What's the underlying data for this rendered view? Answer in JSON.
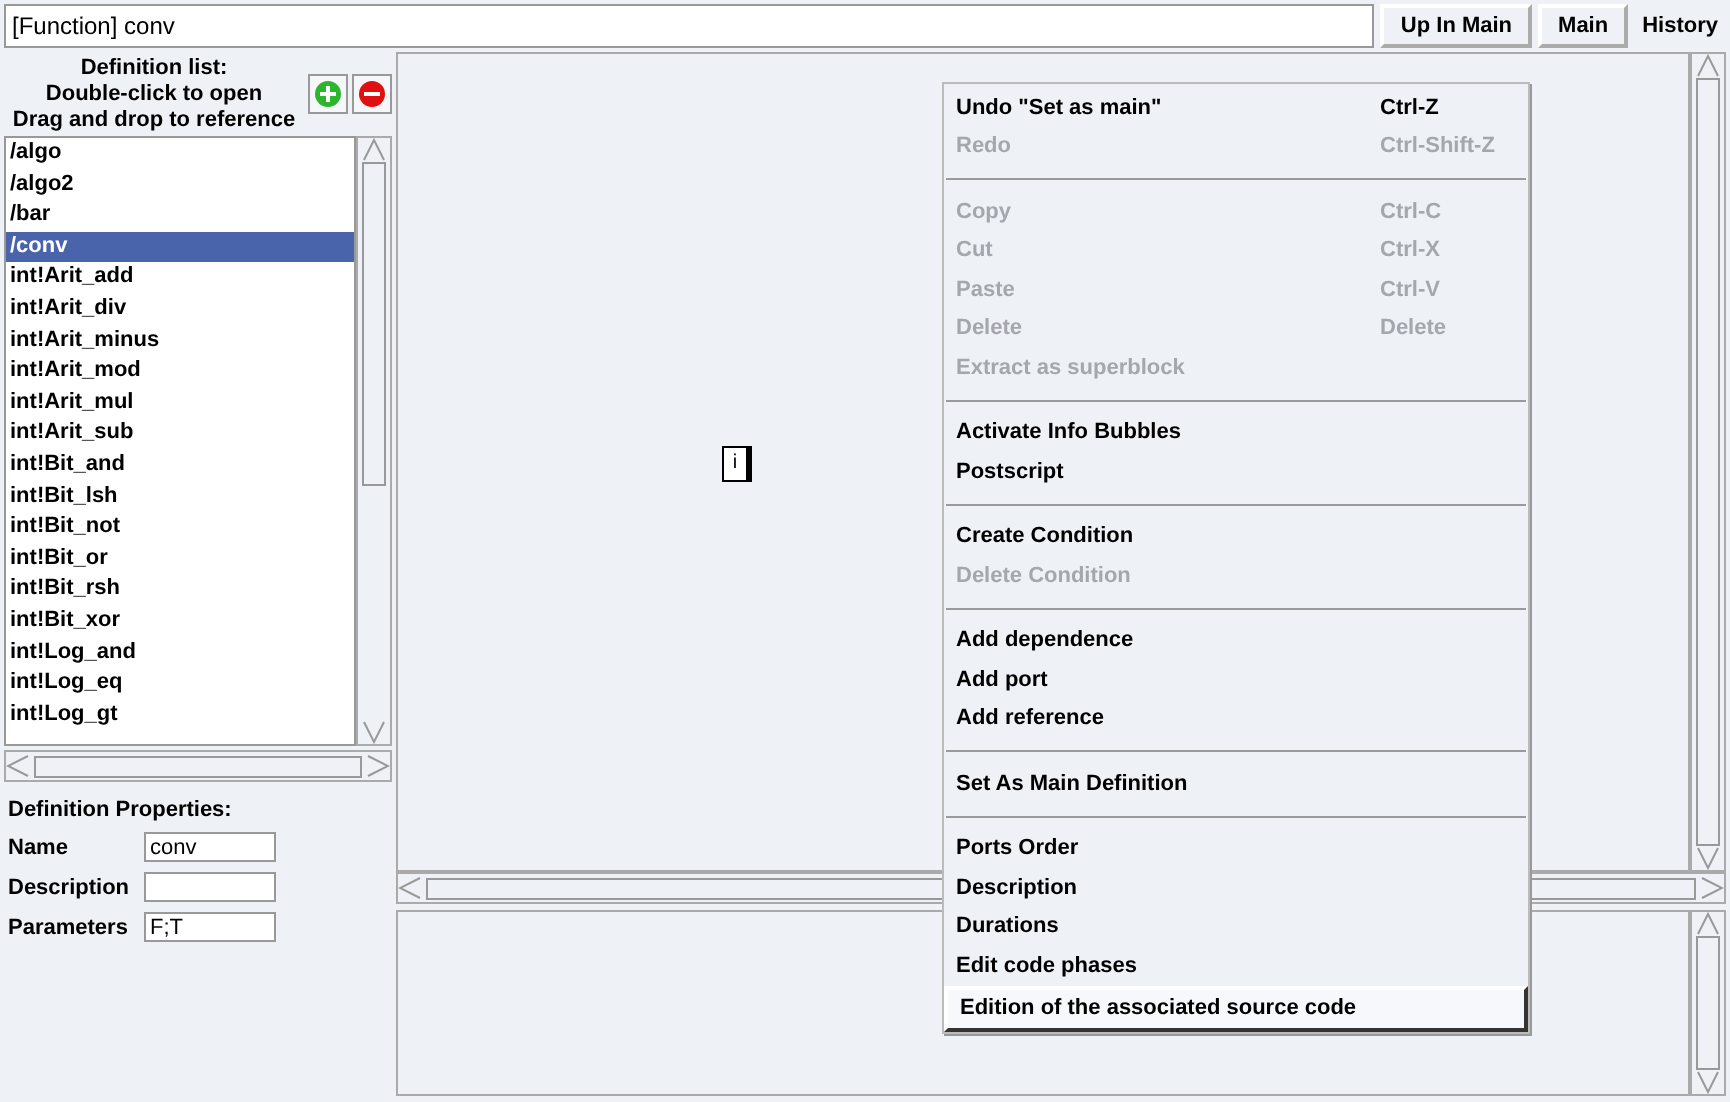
{
  "path_field": {
    "value": "[Function] conv"
  },
  "top_buttons": [
    "Up In Main",
    "Main",
    "History"
  ],
  "definition_list": {
    "header": [
      "Definition list:",
      "Double-click to open",
      "Drag and drop to reference"
    ],
    "items": [
      {
        "label": "/algo",
        "selected": false
      },
      {
        "label": "/algo2",
        "selected": false
      },
      {
        "label": "/bar",
        "selected": false
      },
      {
        "label": "/conv",
        "selected": true
      },
      {
        "label": "int!Arit_add",
        "selected": false
      },
      {
        "label": "int!Arit_div",
        "selected": false
      },
      {
        "label": "int!Arit_minus",
        "selected": false
      },
      {
        "label": "int!Arit_mod",
        "selected": false
      },
      {
        "label": "int!Arit_mul",
        "selected": false
      },
      {
        "label": "int!Arit_sub",
        "selected": false
      },
      {
        "label": "int!Bit_and",
        "selected": false
      },
      {
        "label": "int!Bit_lsh",
        "selected": false
      },
      {
        "label": "int!Bit_not",
        "selected": false
      },
      {
        "label": "int!Bit_or",
        "selected": false
      },
      {
        "label": "int!Bit_rsh",
        "selected": false
      },
      {
        "label": "int!Bit_xor",
        "selected": false
      },
      {
        "label": "int!Log_and",
        "selected": false
      },
      {
        "label": "int!Log_eq",
        "selected": false
      },
      {
        "label": "int!Log_gt",
        "selected": false
      }
    ]
  },
  "properties": {
    "title": "Definition Properties:",
    "fields": [
      {
        "label": "Name",
        "value": "conv"
      },
      {
        "label": "Description"
      },
      {
        "label": "Parameters",
        "value": "F;T"
      }
    ]
  },
  "canvas": {
    "node": {
      "label": "i"
    }
  },
  "context_menu": [
    {
      "kind": "item",
      "label": "Undo \"Set as main\"",
      "shortcut": "Ctrl-Z",
      "disabled": false,
      "selected": false
    },
    {
      "kind": "item",
      "label": "Redo",
      "shortcut": "Ctrl-Shift-Z",
      "disabled": true,
      "selected": false
    },
    {
      "kind": "separator"
    },
    {
      "kind": "item",
      "label": "Copy",
      "shortcut": "Ctrl-C",
      "disabled": true,
      "selected": false
    },
    {
      "kind": "item",
      "label": "Cut",
      "shortcut": "Ctrl-X",
      "disabled": true,
      "selected": false
    },
    {
      "kind": "item",
      "label": "Paste",
      "shortcut": "Ctrl-V",
      "disabled": true,
      "selected": false
    },
    {
      "kind": "item",
      "label": "Delete",
      "shortcut": "Delete",
      "disabled": true,
      "selected": false
    },
    {
      "kind": "item",
      "label": "Extract as superblock",
      "disabled": true,
      "selected": false
    },
    {
      "kind": "separator"
    },
    {
      "kind": "item",
      "label": "Activate Info Bubbles",
      "disabled": false,
      "selected": false
    },
    {
      "kind": "item",
      "label": "Postscript",
      "disabled": false,
      "selected": false
    },
    {
      "kind": "separator"
    },
    {
      "kind": "item",
      "label": "Create Condition",
      "disabled": false,
      "selected": false
    },
    {
      "kind": "item",
      "label": "Delete Condition",
      "disabled": true,
      "selected": false
    },
    {
      "kind": "separator"
    },
    {
      "kind": "item",
      "label": "Add dependence",
      "disabled": false,
      "selected": false
    },
    {
      "kind": "item",
      "label": "Add port",
      "disabled": false,
      "selected": false
    },
    {
      "kind": "item",
      "label": "Add reference",
      "disabled": false,
      "selected": false
    },
    {
      "kind": "separator"
    },
    {
      "kind": "item",
      "label": "Set As Main Definition",
      "disabled": false,
      "selected": false
    },
    {
      "kind": "separator"
    },
    {
      "kind": "item",
      "label": "Ports Order",
      "disabled": false,
      "selected": false
    },
    {
      "kind": "item",
      "label": "Description",
      "disabled": false,
      "selected": false
    },
    {
      "kind": "item",
      "label": "Durations",
      "disabled": false,
      "selected": false
    },
    {
      "kind": "item",
      "label": "Edit code phases",
      "disabled": false,
      "selected": false
    },
    {
      "kind": "item",
      "label": "Edition of the associated source code",
      "disabled": false,
      "selected": true
    }
  ]
}
